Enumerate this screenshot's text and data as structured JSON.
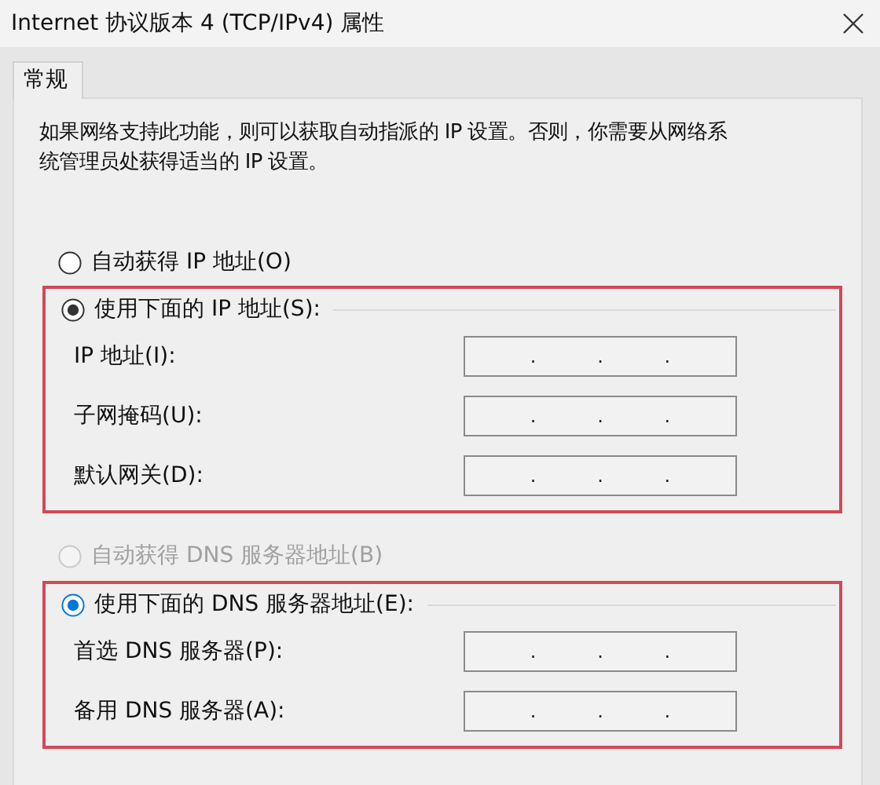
{
  "window": {
    "title": "Internet 协议版本 4 (TCP/IPv4) 属性"
  },
  "tabs": [
    {
      "label": "常规",
      "selected": true
    }
  ],
  "description": "如果网络支持此功能，则可以获取自动指派的 IP 设置。否则，你需要从网络系统管理员处获得适当的 IP 设置。",
  "sections": [
    {
      "auto_option": {
        "label": "自动获得 IP 地址(O)",
        "selected": false,
        "disabled": false,
        "focused": false
      },
      "highlighted": true,
      "manual_option": {
        "label": "使用下面的 IP 地址(S):",
        "selected": true,
        "disabled": false,
        "focused": false
      },
      "fields": [
        {
          "label": "IP 地址(I):",
          "separators": [
            ".",
            ".",
            "."
          ]
        },
        {
          "label": "子网掩码(U):",
          "separators": [
            ".",
            ".",
            "."
          ]
        },
        {
          "label": "默认网关(D):",
          "separators": [
            ".",
            ".",
            "."
          ]
        }
      ]
    },
    {
      "auto_option": {
        "label": "自动获得 DNS 服务器地址(B)",
        "selected": false,
        "disabled": true,
        "focused": false
      },
      "highlighted": true,
      "manual_option": {
        "label": "使用下面的 DNS 服务器地址(E):",
        "selected": true,
        "disabled": false,
        "focused": true
      },
      "fields": [
        {
          "label": "首选 DNS 服务器(P):",
          "separators": [
            ".",
            ".",
            "."
          ]
        },
        {
          "label": "备用 DNS 服务器(A):",
          "separators": [
            ".",
            ".",
            "."
          ]
        }
      ]
    }
  ]
}
